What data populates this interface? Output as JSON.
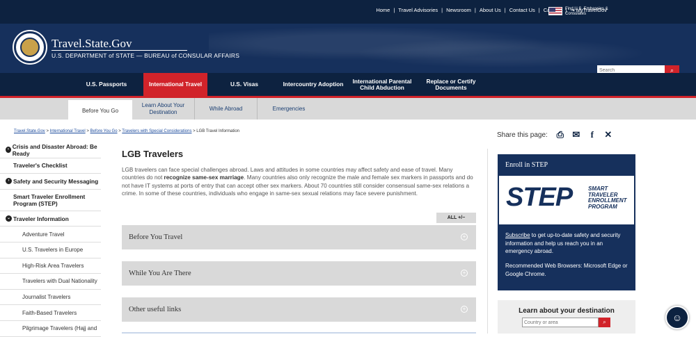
{
  "topbar": {
    "links": [
      "Home",
      "Travel Advisories",
      "Newsroom",
      "About Us",
      "Contact Us",
      "Careers",
      "MyTravelGov"
    ],
    "embassy_line1": "Find U.S. Embassies &",
    "embassy_line2": "Consulates"
  },
  "header": {
    "site_title": "Travel.State.Gov",
    "site_subtitle": "U.S. DEPARTMENT of STATE — BUREAU of CONSULAR AFFAIRS",
    "search_placeholder": "Search"
  },
  "nav": {
    "items": [
      "U.S. Passports",
      "International Travel",
      "U.S. Visas",
      "Intercountry Adoption",
      "International Parental Child Abduction",
      "Replace or Certify Documents"
    ]
  },
  "subnav": {
    "items": [
      "Before You Go",
      "Learn About Your Destination",
      "While Abroad",
      "Emergencies"
    ]
  },
  "breadcrumb": {
    "items": [
      "Travel.State.Gov",
      "International Travel",
      "Before You Go",
      "Travelers with Special Considerations"
    ],
    "current": "LGB Travel Information"
  },
  "share": {
    "label": "Share this page:"
  },
  "leftnav": {
    "items": [
      "Crisis and Disaster Abroad: Be Ready",
      "Traveler's Checklist",
      "Safety and Security Messaging",
      "Smart Traveler Enrollment Program (STEP)",
      "Traveler Information",
      "Adventure Travel",
      "U.S. Travelers in Europe",
      "High-Risk Area Travelers",
      "Travelers with Dual Nationality",
      "Journalist Travelers",
      "Faith-Based Travelers",
      "Pilgrimage Travelers (Hajj and"
    ]
  },
  "main": {
    "title": "LGB Travelers",
    "intro_1": "LGB travelers can face special challenges abroad. Laws and attitudes in some countries may affect safety and ease of travel. Many countries do not ",
    "intro_bold": "recognize same-sex marriage",
    "intro_2": ". Many countries also only recognize the male and female sex markers in passports and do not have IT systems at ports of entry that can accept other sex markers. About 70 countries still consider consensual same-sex relations a crime. In some of these countries, individuals who engage in same-sex sexual relations may face severe punishment.",
    "all_toggle": "ALL +/−",
    "accordions": [
      "Before You Travel",
      "While You Are There",
      "Other useful links"
    ]
  },
  "step": {
    "heading": "Enroll in STEP",
    "logo_big": "STEP",
    "logo_small_1": "SMART",
    "logo_small_2": "TRAVELER",
    "logo_small_3": "ENROLLMENT",
    "logo_small_4": "PROGRAM",
    "subscribe": "Subscribe",
    "text": " to get up-to-date safety and security information and help us reach you in an emergency abroad.",
    "browsers": "Recommended Web Browsers: Microsoft Edge or Google Chrome."
  },
  "destination": {
    "title": "Learn about your destination",
    "placeholder": "Country or area"
  },
  "colors": {
    "navy": "#0d2240",
    "header": "#16305c",
    "red": "#d1232a",
    "gray": "#d9d9d9"
  }
}
